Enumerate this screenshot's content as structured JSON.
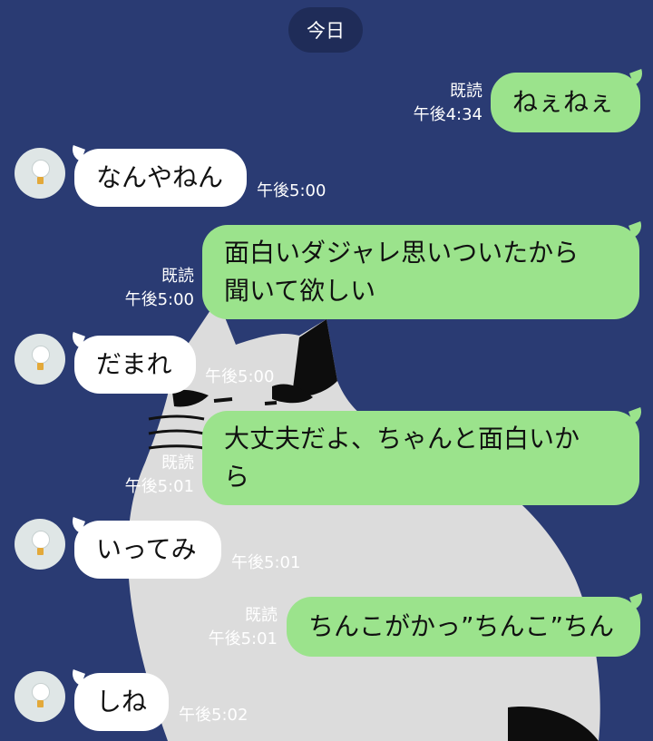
{
  "date_label": "今日",
  "messages": [
    {
      "side": "out",
      "text": "ねぇねぇ",
      "read": "既読",
      "time": "午後4:34"
    },
    {
      "side": "in",
      "text": "なんやねん",
      "time": "午後5:00"
    },
    {
      "side": "out",
      "text_lines": [
        "面白いダジャレ思いついたから",
        "聞いて欲しい"
      ],
      "read": "既読",
      "time": "午後5:00"
    },
    {
      "side": "in",
      "text": "だまれ",
      "time": "午後5:00"
    },
    {
      "side": "out",
      "text_lines": [
        "大丈夫だよ、ちゃんと面白いか",
        "ら"
      ],
      "read": "既読",
      "time": "午後5:01"
    },
    {
      "side": "in",
      "text": "いってみ",
      "time": "午後5:01"
    },
    {
      "side": "out",
      "text": "ちんこがかっ”ちんこ”ちん",
      "read": "既読",
      "time": "午後5:01"
    },
    {
      "side": "in",
      "text": "しね",
      "time": "午後5:02"
    }
  ],
  "colors": {
    "background": "#2a3b73",
    "outgoing_bubble": "#9be38c",
    "incoming_bubble": "#ffffff"
  }
}
